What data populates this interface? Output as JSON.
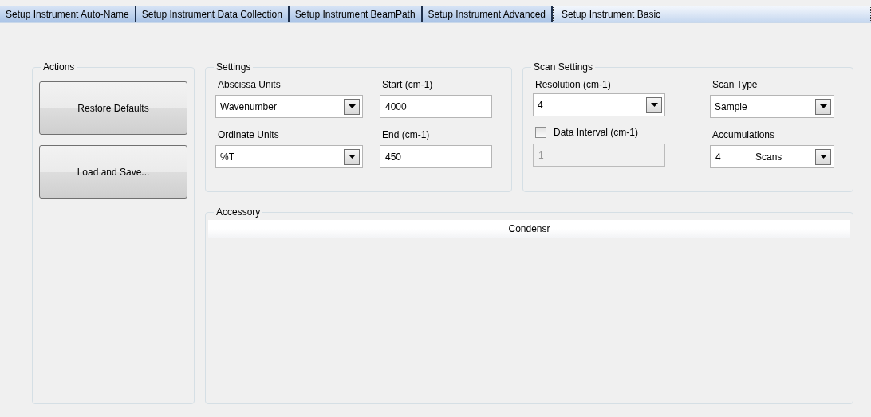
{
  "tabs": [
    {
      "label": "Setup Instrument Auto-Name",
      "selected": false
    },
    {
      "label": "Setup Instrument Data Collection",
      "selected": false
    },
    {
      "label": "Setup Instrument BeamPath",
      "selected": false
    },
    {
      "label": "Setup Instrument Advanced",
      "selected": false
    },
    {
      "label": "Setup Instrument Basic",
      "selected": true
    }
  ],
  "actions": {
    "title": "Actions",
    "buttons": [
      "Restore Defaults",
      "Load and Save..."
    ]
  },
  "settings": {
    "title": "Settings",
    "columns": [
      [
        {
          "kind": "label",
          "text": "Abscissa Units"
        },
        {
          "kind": "select",
          "value": "Wavenumber"
        },
        {
          "kind": "label",
          "text": "Ordinate Units"
        },
        {
          "kind": "select",
          "value": "%T"
        }
      ],
      [
        {
          "kind": "label",
          "text": "Start (cm-1)"
        },
        {
          "kind": "text",
          "value": "4000",
          "disabled": false
        },
        {
          "kind": "label",
          "text": "End (cm-1)"
        },
        {
          "kind": "text",
          "value": "450",
          "disabled": false
        }
      ]
    ]
  },
  "scan_settings": {
    "title": "Scan Settings",
    "columns": [
      [
        {
          "kind": "label",
          "text": "Resolution (cm-1)"
        },
        {
          "kind": "select",
          "value": "4"
        },
        {
          "kind": "checkbox",
          "text": "Data Interval (cm-1)",
          "checked": false
        },
        {
          "kind": "text",
          "value": "1",
          "disabled": true
        }
      ],
      [
        {
          "kind": "label",
          "text": "Scan Type"
        },
        {
          "kind": "select",
          "value": "Sample"
        },
        {
          "kind": "label",
          "text": "Accumulations"
        },
        {
          "kind": "count",
          "value": "4",
          "unit": "Scans"
        }
      ]
    ]
  },
  "accessory": {
    "title": "Accessory",
    "columns": [
      "Condensr"
    ]
  }
}
